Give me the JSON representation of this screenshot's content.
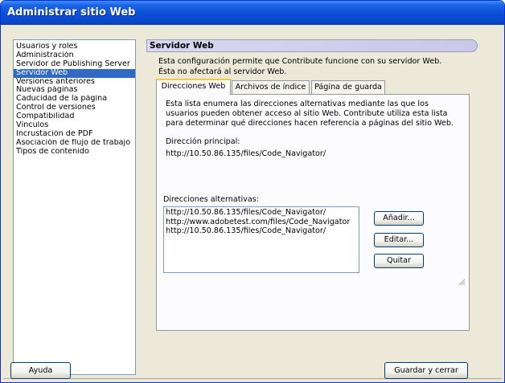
{
  "window": {
    "title": "Administrar sitio Web"
  },
  "sidebar": {
    "items": [
      {
        "label": "Usuarios y roles",
        "selected": false
      },
      {
        "label": "Administración",
        "selected": false
      },
      {
        "label": "Servidor de Publishing Server",
        "selected": false
      },
      {
        "label": "Servidor Web",
        "selected": true
      },
      {
        "label": "Versiones anteriores",
        "selected": false
      },
      {
        "label": "Nuevas páginas",
        "selected": false
      },
      {
        "label": "Caducidad de la página",
        "selected": false
      },
      {
        "label": "Control de versiones",
        "selected": false
      },
      {
        "label": "Compatibilidad",
        "selected": false
      },
      {
        "label": "Vínculos",
        "selected": false
      },
      {
        "label": "Incrustación de PDF",
        "selected": false
      },
      {
        "label": "Asociación de flujo de trabajo",
        "selected": false
      },
      {
        "label": "Tipos de contenido",
        "selected": false
      }
    ]
  },
  "panel": {
    "title": "Servidor Web",
    "description": "Esta configuración permite que Contribute funcione con su servidor Web. Ésta no afectará al servidor Web."
  },
  "tabs": [
    {
      "label": "Direcciones Web",
      "active": true
    },
    {
      "label": "Archivos de índice",
      "active": false
    },
    {
      "label": "Página de guarda",
      "active": false
    }
  ],
  "tab_content": {
    "description": "Esta lista enumera las direcciones alternativas mediante las que los usuarios pueden obtener acceso al sitio Web. Contribute utiliza esta lista para determinar qué direcciones hacen referencia a páginas del sitio Web.",
    "primary_label": "Dirección principal:",
    "primary_value": "http://10.50.86.135/files/Code_Navigator/",
    "alternate_label": "Direcciones alternativas:",
    "alternates": [
      "http://10.50.86.135/files/Code_Navigator/",
      "http://www.adobetest.com/files/Code_Navigator",
      "http://10.50.86.135/files/Code_Navigator/"
    ],
    "add_label": "Añadir...",
    "edit_label": "Editar...",
    "remove_label": "Quitar"
  },
  "footer": {
    "help_label": "Ayuda",
    "save_label": "Guardar y cerrar"
  },
  "colors": {
    "titlebar": "#0a4fd8",
    "selection": "#316ac5",
    "tab_accent": "#ffc83c",
    "dialog_bg": "#ece9d8"
  }
}
